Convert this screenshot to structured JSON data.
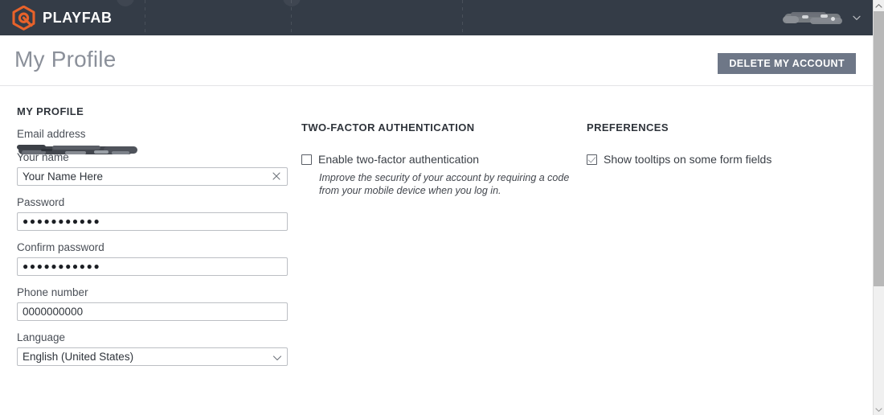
{
  "topbar": {
    "brand_name": "PLAYFAB",
    "logo_icon": "playfab-hexagon-logo",
    "accent_color": "#e8622a",
    "background_color": "#343c47",
    "user_menu": {
      "name_redacted": true,
      "chevron_icon": "chevron-down-icon"
    }
  },
  "page_header": {
    "title": "My Profile",
    "delete_button_label": "DELETE MY ACCOUNT",
    "delete_button_color": "#6e7787"
  },
  "columns": {
    "profile": {
      "section_title": "MY PROFILE",
      "fields": {
        "email": {
          "label": "Email address",
          "value_redacted": true
        },
        "name": {
          "label": "Your name",
          "value": "Your Name Here",
          "clear_icon": "close-x-icon"
        },
        "password": {
          "label": "Password",
          "value": "●●●●●●●●●●●"
        },
        "confirm_password": {
          "label": "Confirm password",
          "value": "●●●●●●●●●●●"
        },
        "phone": {
          "label": "Phone number",
          "value": "0000000000"
        },
        "language": {
          "label": "Language",
          "value": "English (United States)",
          "chevron_icon": "chevron-down-icon"
        }
      }
    },
    "two_factor": {
      "section_title": "TWO-FACTOR AUTHENTICATION",
      "checkbox_label": "Enable two-factor authentication",
      "checked": false,
      "help_text": "Improve the security of your account by requiring a code from your mobile device when you log in."
    },
    "preferences": {
      "section_title": "PREFERENCES",
      "checkbox_label": "Show tooltips on some form fields",
      "checked": true
    }
  },
  "scrollbar": {
    "up_icon": "scroll-up-arrow-icon",
    "down_icon": "scroll-down-arrow-icon"
  }
}
